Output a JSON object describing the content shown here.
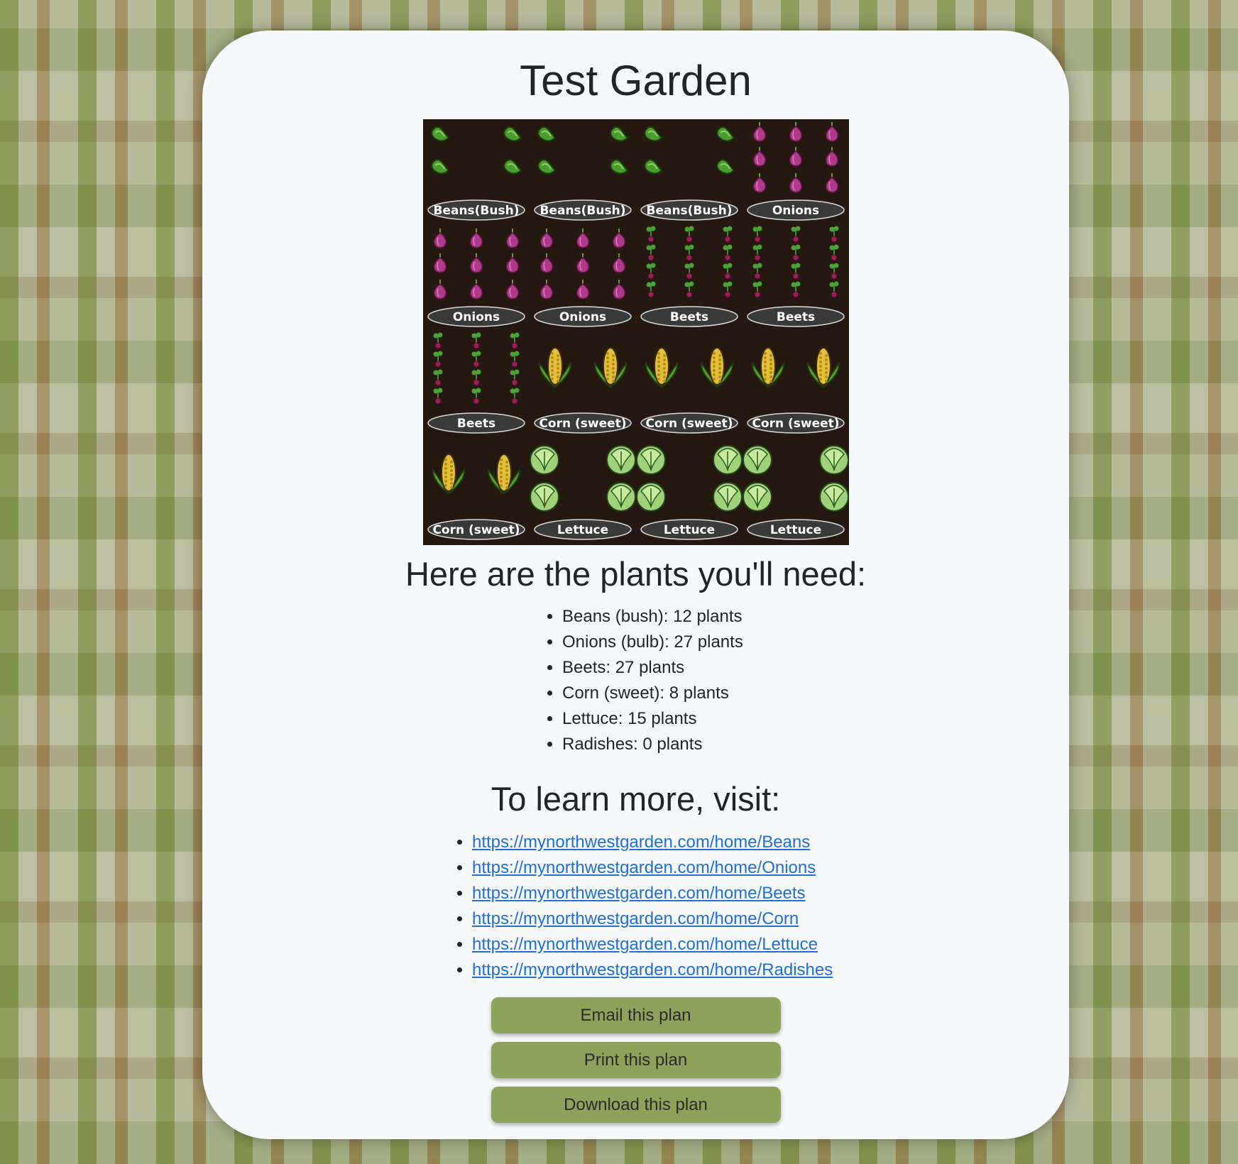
{
  "page": {
    "title": "Test Garden"
  },
  "garden": {
    "background": "#251810",
    "label_bg": "#3a3a3a",
    "plots": [
      {
        "label": "Beans(Bush)",
        "plant": "beans"
      },
      {
        "label": "Beans(Bush)",
        "plant": "beans"
      },
      {
        "label": "Beans(Bush)",
        "plant": "beans"
      },
      {
        "label": "Onions",
        "plant": "onions"
      },
      {
        "label": "Onions",
        "plant": "onions"
      },
      {
        "label": "Onions",
        "plant": "onions"
      },
      {
        "label": "Beets",
        "plant": "beets"
      },
      {
        "label": "Beets",
        "plant": "beets"
      },
      {
        "label": "Beets",
        "plant": "beets"
      },
      {
        "label": "Corn (sweet)",
        "plant": "corn"
      },
      {
        "label": "Corn (sweet)",
        "plant": "corn"
      },
      {
        "label": "Corn (sweet)",
        "plant": "corn"
      },
      {
        "label": "Corn (sweet)",
        "plant": "corn"
      },
      {
        "label": "Lettuce",
        "plant": "lettuce"
      },
      {
        "label": "Lettuce",
        "plant": "lettuce"
      },
      {
        "label": "Lettuce",
        "plant": "lettuce"
      }
    ]
  },
  "needs": {
    "heading": "Here are the plants you'll need:",
    "items": [
      "Beans (bush): 12 plants",
      "Onions (bulb): 27 plants",
      "Beets: 27 plants",
      "Corn (sweet): 8 plants",
      "Lettuce: 15 plants",
      "Radishes: 0 plants"
    ]
  },
  "learn": {
    "heading": "To learn more, visit:",
    "links": [
      "https://mynorthwestgarden.com/home/Beans",
      "https://mynorthwestgarden.com/home/Onions",
      "https://mynorthwestgarden.com/home/Beets",
      "https://mynorthwestgarden.com/home/Corn",
      "https://mynorthwestgarden.com/home/Lettuce",
      "https://mynorthwestgarden.com/home/Radishes"
    ]
  },
  "buttons": {
    "email": "Email this plan",
    "print": "Print this plan",
    "download": "Download this plan",
    "color": "#8da35c"
  },
  "background_icons": "vegetable-illustration-pattern"
}
